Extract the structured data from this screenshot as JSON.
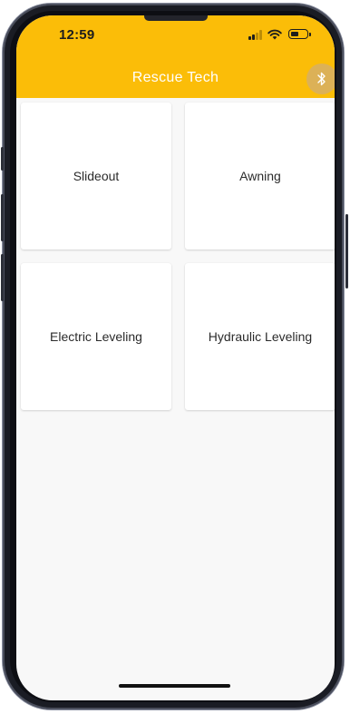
{
  "status_bar": {
    "time": "12:59",
    "signal_icon": "cellular-signal-icon",
    "wifi_icon": "wifi-icon",
    "battery_icon": "battery-icon"
  },
  "app_bar": {
    "title": "Rescue Tech",
    "background_color": "#fbbd08",
    "bluetooth_button_icon": "bluetooth-icon"
  },
  "cards": [
    {
      "label": "Slideout"
    },
    {
      "label": "Awning"
    },
    {
      "label": "Electric Leveling"
    },
    {
      "label": "Hydraulic Leveling"
    }
  ]
}
